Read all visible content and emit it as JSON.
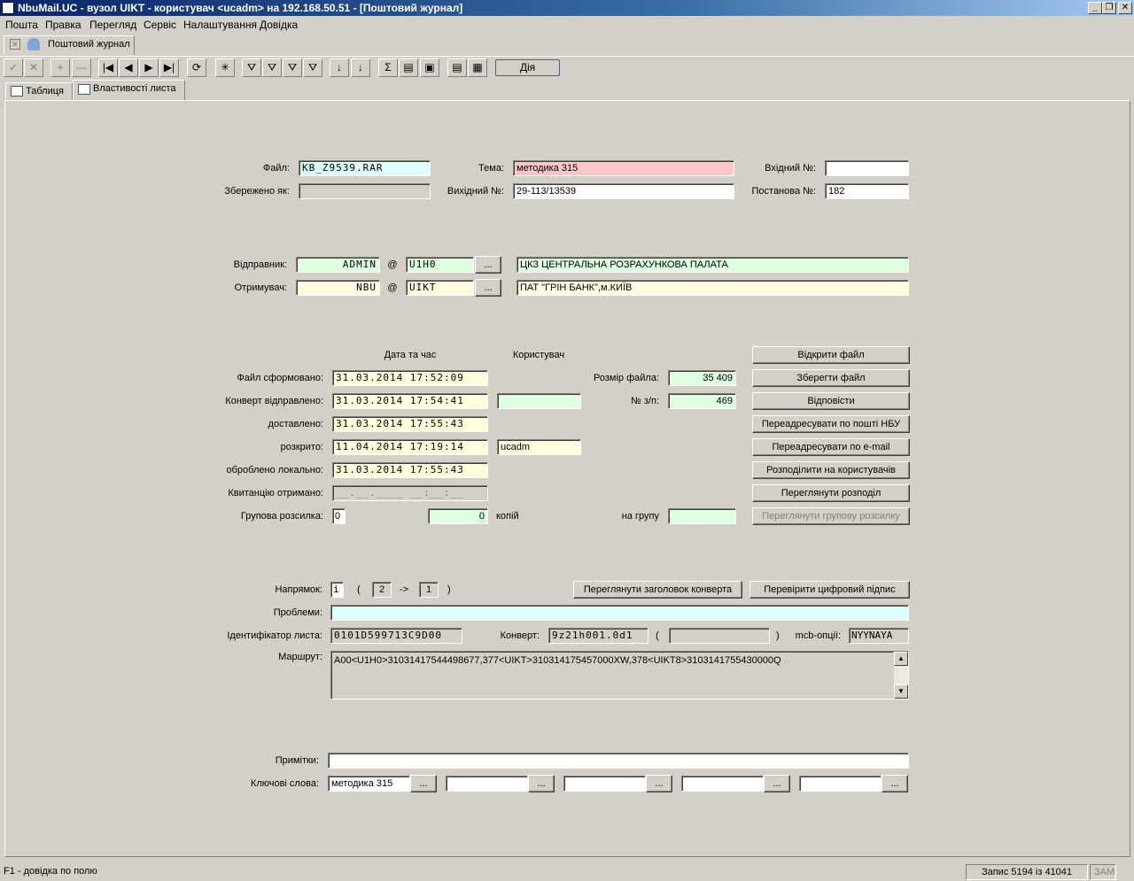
{
  "window": {
    "title": "NbuMail.UC - вузол UIKT - користувач <ucadm> на 192.168.50.51 - [Поштовий журнал]",
    "min": "_",
    "restore": "❐",
    "close": "✕"
  },
  "menu": [
    "Пошта",
    "Правка",
    "Перегляд",
    "Сервіс",
    "Налаштування",
    "Довідка"
  ],
  "doc_tab": {
    "label": "Поштовий журнал"
  },
  "toolbar": {
    "buttons": [
      "✓",
      "✕",
      "+",
      "—",
      "|◀",
      "◀",
      "▶",
      "▶|",
      "⟳",
      "✳",
      "⛛",
      "⛛",
      "⛛",
      "⛛",
      "↓",
      "↓",
      "Σ",
      "▤",
      "▣",
      "▤",
      "▦"
    ],
    "action_label": "Дія"
  },
  "tabs": {
    "table": "Таблиця",
    "props": "Властивості листа"
  },
  "file": {
    "label": "Файл:",
    "value": "KB_Z9539.RAR"
  },
  "saved_as": {
    "label": "Збережено як:",
    "value": ""
  },
  "topic": {
    "label": "Тема:",
    "value": "методика 315"
  },
  "outgoing": {
    "label": "Вихідний №:",
    "value": "29-113/13539"
  },
  "incoming": {
    "label": "Вхідний №:",
    "value": ""
  },
  "decree": {
    "label": "Постанова №:",
    "value": "182"
  },
  "sender": {
    "label": "Відправник:",
    "user": "ADMIN",
    "at": "@",
    "node": "U1H0",
    "browse": "...",
    "name": "ЦКЗ ЦЕНТРАЛЬНА РОЗРАХУНКОВА ПАЛАТА"
  },
  "receiver": {
    "label": "Отримувач:",
    "user": "NBU",
    "at": "@",
    "node": "UIKT",
    "browse": "...",
    "name": "ПАТ \"ГРІН БАНК\",м.КИЇВ"
  },
  "headers": {
    "datetime": "Дата та час",
    "user": "Користувач"
  },
  "dates": {
    "formed": {
      "label": "Файл сформовано:",
      "value": "31.03.2014 17:52:09"
    },
    "sent": {
      "label": "Конверт відправлено:",
      "value": "31.03.2014 17:54:41",
      "user": ""
    },
    "delivered": {
      "label": "доставлено:",
      "value": "31.03.2014 17:55:43"
    },
    "opened": {
      "label": "розкрито:",
      "value": "11.04.2014 17:19:14",
      "user": "ucadm"
    },
    "processed": {
      "label": "оброблено локально:",
      "value": "31.03.2014 17:55:43"
    },
    "receipt": {
      "label": "Квитанцію отримано:",
      "value": "__.__.____ __:__:__"
    }
  },
  "group": {
    "label": "Групова розсилка:",
    "value": "0",
    "copies": "0",
    "copies_label": "копій",
    "to_group_label": "на групу",
    "to_group": ""
  },
  "filesize": {
    "label": "Розмір файла:",
    "value": "35 409"
  },
  "seq": {
    "label": "№ з/п:",
    "value": "469"
  },
  "actions": {
    "open_file": "Відкрити файл",
    "save_file": "Зберегти файл",
    "reply": "Відповісти",
    "forward_nbu": "Переадресувати по пошті НБУ",
    "forward_email": "Переадресувати по e-mail",
    "distribute": "Розподілити на користувачів",
    "view_distribution": "Переглянути розподіл",
    "view_group": "Переглянути групову розсилку",
    "view_header": "Переглянути заголовок конверта",
    "verify_signature": "Перевірити цифровий підпис"
  },
  "direction": {
    "label": "Напрямок:",
    "value": "i",
    "open_paren": "(",
    "from": "2",
    "arrow": "->",
    "to": "1",
    "close_paren": ")"
  },
  "problems": {
    "label": "Проблеми:",
    "value": ""
  },
  "letter_id": {
    "label": "Ідентифікатор листа:",
    "value": "0101D599713C9D00"
  },
  "envelope": {
    "label": "Конверт:",
    "value": "9z21h001.0d1",
    "open_paren": "(",
    "extra": "",
    "close_paren": ")"
  },
  "mcb": {
    "label": "mcb-опції:",
    "value": "NYYNAYA"
  },
  "route": {
    "label": "Маршрут:",
    "value": "A00<U1H0>31031417544498677,377<UIKT>310314175457000XW,378<UIKT8>3103141755430000Q"
  },
  "notes": {
    "label": "Примітки:",
    "value": ""
  },
  "keywords": {
    "label": "Ключові слова:",
    "values": [
      "методика 315",
      "",
      "",
      "",
      ""
    ],
    "browse": "..."
  },
  "status": {
    "help": "F1 - довідка по полю",
    "record": "Запис 5194 із 41041",
    "caps": "ЗАМ"
  }
}
